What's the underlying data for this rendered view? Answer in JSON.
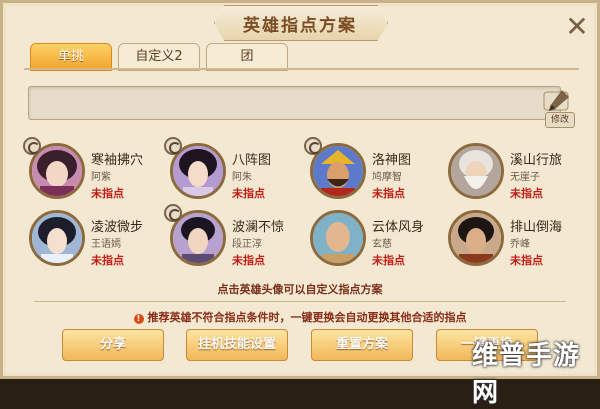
{
  "window": {
    "title": "英雄指点方案",
    "close": "✕"
  },
  "tabs": [
    {
      "label": "单挑",
      "active": true
    },
    {
      "label": "自定义2",
      "active": false
    },
    {
      "label": "团",
      "active": false
    }
  ],
  "edit_button": {
    "label": "修改"
  },
  "heroes": [
    {
      "name": "寒袖拂穴",
      "skill": "阿紫",
      "status": "未指点",
      "palette": {
        "bg": "#c78bb0",
        "face": "#f3d7c6",
        "hair": "#3a1f2c"
      }
    },
    {
      "name": "八阵图",
      "skill": "阿朱",
      "status": "未指点",
      "palette": {
        "bg": "#b39ad1",
        "face": "#f4dcc9",
        "hair": "#1e1420"
      }
    },
    {
      "name": "洛神图",
      "skill": "鸠摩智",
      "status": "未指点",
      "palette": {
        "bg": "#5d79c9",
        "face": "#d9a06b",
        "hair": "#b3261b"
      }
    },
    {
      "name": "溪山行旅",
      "skill": "无崖子",
      "status": "未指点",
      "palette": {
        "bg": "#b3a59b",
        "face": "#efd4b9",
        "hair": "#e8e4dc"
      }
    },
    {
      "name": "凌波微步",
      "skill": "王语嫣",
      "status": "未指点",
      "palette": {
        "bg": "#9fb7d5",
        "face": "#f5dfce",
        "hair": "#1c1e2b"
      }
    },
    {
      "name": "波澜不惊",
      "skill": "段正淳",
      "status": "未指点",
      "palette": {
        "bg": "#b7a2cf",
        "face": "#f0d6c0",
        "hair": "#1a1521"
      }
    },
    {
      "name": "云体风身",
      "skill": "玄慈",
      "status": "未指点",
      "palette": {
        "bg": "#7fb2c6",
        "face": "#e2b78f",
        "hair": "#d7c2a1"
      }
    },
    {
      "name": "排山倒海",
      "skill": "乔峰",
      "status": "未指点",
      "palette": {
        "bg": "#c9a98a",
        "face": "#dcae87",
        "hair": "#1d1613"
      }
    }
  ],
  "hint": "点击英雄头像可以自定义指点方案",
  "warning": "推荐英雄不符合指点条件时，一键更换会自动更换其他合适的指点",
  "buttons": [
    "分享",
    "挂机技能设置",
    "重置方案",
    "一键更换"
  ],
  "watermark": "维普手游网",
  "colors": {
    "accent": "#f1a22c",
    "status_red": "#c21d14",
    "panel_bg": "#f3e9d3"
  }
}
